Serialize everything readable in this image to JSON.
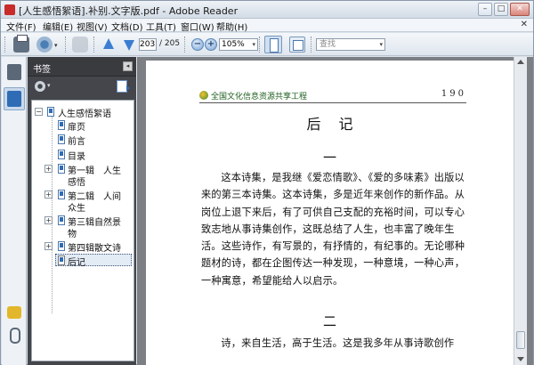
{
  "window": {
    "title": "[人生感悟絮语].补别.文字版.pdf - Adobe Reader",
    "minimize": "–",
    "maximize": "□",
    "close": "✕"
  },
  "menu": {
    "items": [
      "文件(F)",
      "编辑(E)",
      "视图(V)",
      "文档(D)",
      "工具(T)",
      "窗口(W)",
      "帮助(H)"
    ],
    "close_doc": "✕"
  },
  "toolbar": {
    "current_page": "203",
    "page_total": "/ 205",
    "zoom_out": "−",
    "zoom_in": "+",
    "zoom_value": "105%",
    "find_placeholder": "查找",
    "dropdown_glyph": "▾"
  },
  "bookmarks": {
    "panel_title": "书签",
    "collapse_glyph": "◂",
    "items": [
      {
        "label": "人生感悟絮语",
        "toggle": "−"
      },
      {
        "label": "扉页",
        "toggle": ""
      },
      {
        "label": "前言",
        "toggle": ""
      },
      {
        "label": "目录",
        "toggle": ""
      },
      {
        "label": "第一辑　人生",
        "label2": "感悟",
        "toggle": "+"
      },
      {
        "label": "第二辑　人间",
        "label2": "众生",
        "toggle": "+"
      },
      {
        "label": "第三辑自然景",
        "label2": "物",
        "toggle": "+"
      },
      {
        "label": "第四辑散文诗",
        "toggle": "+"
      },
      {
        "label": "后记",
        "toggle": ""
      }
    ]
  },
  "document": {
    "header_site": "全国文化信息资源共享工程",
    "page_number": "190",
    "title": "后记",
    "section1": "一",
    "paragraph1": "这本诗集，是我继《爱恋情歌》、《爱的多味素》出版以来的第三本诗集。这本诗集，多是近年来创作的新作品。从岗位上退下来后，有了可供自己支配的充裕时间，可以专心致志地从事诗集创作，这既总结了人生，也丰富了晚年生活。这些诗作，有写景的，有抒情的，有纪事的。无论哪种题材的诗，都在企图传达一种发现，一种意境，一种心声，一种寓意，希望能给人以启示。",
    "section2": "二",
    "paragraph2": "诗，来自生活，高于生活。这是我多年从事诗歌创作"
  }
}
